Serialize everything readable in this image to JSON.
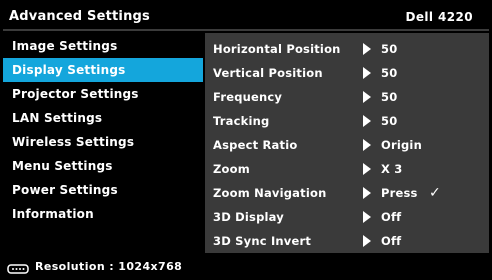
{
  "header": {
    "title": "Advanced Settings",
    "model": "Dell 4220"
  },
  "menu": {
    "items": [
      {
        "label": "Image Settings"
      },
      {
        "label": "Display Settings",
        "selected": true
      },
      {
        "label": "Projector Settings"
      },
      {
        "label": "LAN Settings"
      },
      {
        "label": "Wireless Settings"
      },
      {
        "label": "Menu Settings"
      },
      {
        "label": "Power Settings"
      },
      {
        "label": "Information"
      }
    ]
  },
  "panel": {
    "rows": [
      {
        "label": "Horizontal Position",
        "value": "50"
      },
      {
        "label": "Vertical Position",
        "value": "50"
      },
      {
        "label": "Frequency",
        "value": "50"
      },
      {
        "label": "Tracking",
        "value": "50"
      },
      {
        "label": "Aspect Ratio",
        "value": "Origin"
      },
      {
        "label": "Zoom",
        "value": "X 3"
      },
      {
        "label": "Zoom Navigation",
        "value": "Press",
        "check": "✓"
      },
      {
        "label": "3D Display",
        "value": "Off"
      },
      {
        "label": "3D Sync Invert",
        "value": "Off"
      }
    ]
  },
  "status": {
    "icon": "monitor-input-icon",
    "text": "Resolution : 1024x768"
  },
  "colors": {
    "accent": "#14a6dc",
    "panel_bg": "#3a3a3a",
    "background": "#000000"
  }
}
